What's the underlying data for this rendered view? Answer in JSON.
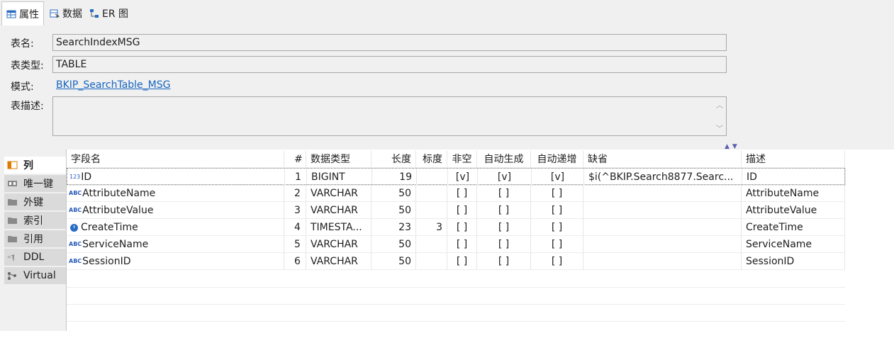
{
  "tabs": [
    {
      "label": "属性",
      "icon": "table-properties-icon"
    },
    {
      "label": "数据",
      "icon": "data-icon"
    },
    {
      "label": "ER 图",
      "icon": "er-diagram-icon"
    }
  ],
  "props": {
    "table_name_label": "表名:",
    "table_name_value": "SearchIndexMSG",
    "table_type_label": "表类型:",
    "table_type_value": "TABLE",
    "schema_label": "模式:",
    "schema_link": "BKIP_SearchTable_MSG",
    "description_label": "表描述:",
    "description_value": ""
  },
  "side_tabs": [
    {
      "label": "列",
      "icon": "columns-icon"
    },
    {
      "label": "唯一键",
      "icon": "unique-key-icon"
    },
    {
      "label": "外键",
      "icon": "folder-icon"
    },
    {
      "label": "索引",
      "icon": "folder-icon"
    },
    {
      "label": "引用",
      "icon": "folder-icon"
    },
    {
      "label": "DDL",
      "icon": "ddl-icon"
    },
    {
      "label": "Virtual",
      "icon": "virtual-icon"
    }
  ],
  "grid": {
    "headers": {
      "name": "字段名",
      "num": "#",
      "type": "数据类型",
      "length": "长度",
      "scale": "标度",
      "notnull": "非空",
      "autogen": "自动生成",
      "autoinc": "自动递增",
      "default": "缺省",
      "comment": "描述"
    },
    "rows": [
      {
        "icon": "123",
        "name": "ID",
        "num": "1",
        "type": "BIGINT",
        "length": "19",
        "scale": "",
        "notnull": "[v]",
        "autogen": "[v]",
        "autoinc": "[v]",
        "default": "$i(^BKIP.Search8877.Searc...",
        "comment": "ID"
      },
      {
        "icon": "ABC",
        "name": "AttributeName",
        "num": "2",
        "type": "VARCHAR",
        "length": "50",
        "scale": "",
        "notnull": "[ ]",
        "autogen": "[ ]",
        "autoinc": "[ ]",
        "default": "",
        "comment": "AttributeName"
      },
      {
        "icon": "ABC",
        "name": "AttributeValue",
        "num": "3",
        "type": "VARCHAR",
        "length": "50",
        "scale": "",
        "notnull": "[ ]",
        "autogen": "[ ]",
        "autoinc": "[ ]",
        "default": "",
        "comment": "AttributeValue"
      },
      {
        "icon": "clock",
        "name": "CreateTime",
        "num": "4",
        "type": "TIMESTA...",
        "length": "23",
        "scale": "3",
        "notnull": "[ ]",
        "autogen": "[ ]",
        "autoinc": "[ ]",
        "default": "",
        "comment": "CreateTime"
      },
      {
        "icon": "ABC",
        "name": "ServiceName",
        "num": "5",
        "type": "VARCHAR",
        "length": "50",
        "scale": "",
        "notnull": "[ ]",
        "autogen": "[ ]",
        "autoinc": "[ ]",
        "default": "",
        "comment": "ServiceName"
      },
      {
        "icon": "ABC",
        "name": "SessionID",
        "num": "6",
        "type": "VARCHAR",
        "length": "50",
        "scale": "",
        "notnull": "[ ]",
        "autogen": "[ ]",
        "autoinc": "[ ]",
        "default": "",
        "comment": "SessionID"
      }
    ]
  },
  "colors": {
    "link": "#1565c0",
    "icon_blue": "#2b5cb8",
    "active_tab_icon": "#e07b00"
  }
}
